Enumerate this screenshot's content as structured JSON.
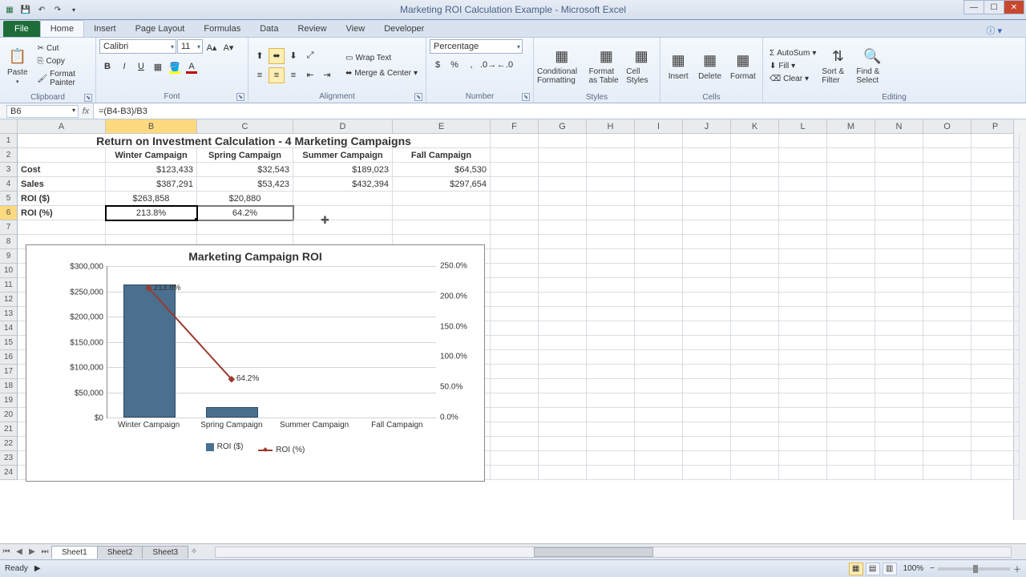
{
  "title": "Marketing ROI Calculation Example - Microsoft Excel",
  "tabs": {
    "file": "File",
    "items": [
      "Home",
      "Insert",
      "Page Layout",
      "Formulas",
      "Data",
      "Review",
      "View",
      "Developer"
    ],
    "active": 0
  },
  "ribbon": {
    "clipboard": {
      "label": "Clipboard",
      "paste": "Paste",
      "cut": "Cut",
      "copy": "Copy",
      "fp": "Format Painter"
    },
    "font": {
      "label": "Font",
      "name": "Calibri",
      "size": "11"
    },
    "alignment": {
      "label": "Alignment",
      "wrap": "Wrap Text",
      "merge": "Merge & Center"
    },
    "number": {
      "label": "Number",
      "fmt": "Percentage"
    },
    "styles": {
      "label": "Styles",
      "cf": "Conditional Formatting",
      "fat": "Format as Table",
      "cs": "Cell Styles"
    },
    "cells": {
      "label": "Cells",
      "insert": "Insert",
      "delete": "Delete",
      "format": "Format"
    },
    "editing": {
      "label": "Editing",
      "sum": "AutoSum",
      "fill": "Fill",
      "clear": "Clear",
      "sort": "Sort & Filter",
      "find": "Find & Select"
    }
  },
  "namebox": "B6",
  "formula": "=(B4-B3)/B3",
  "cols": {
    "A": 110,
    "B": 114,
    "C": 120,
    "D": 124,
    "E": 122,
    "rest": 60
  },
  "table": {
    "title": "Return on Investment Calculation - 4 Marketing Campaigns",
    "headers": [
      "Winter Campaign",
      "Spring Campaign",
      "Summer Campaign",
      "Fall Campaign"
    ],
    "rows": [
      {
        "label": "Cost",
        "vals": [
          "$123,433",
          "$32,543",
          "$189,023",
          "$64,530"
        ]
      },
      {
        "label": "Sales",
        "vals": [
          "$387,291",
          "$53,423",
          "$432,394",
          "$297,654"
        ]
      },
      {
        "label": "ROI ($)",
        "vals": [
          "$263,858",
          "$20,880",
          "",
          ""
        ]
      },
      {
        "label": "ROI (%)",
        "vals": [
          "213.8%",
          "64.2%",
          "",
          ""
        ]
      }
    ]
  },
  "chart_data": {
    "type": "bar",
    "title": "Marketing Campaign ROI",
    "categories": [
      "Winter Campaign",
      "Spring Campaign",
      "Summer Campaign",
      "Fall Campaign"
    ],
    "series": [
      {
        "name": "ROI ($)",
        "type": "bar",
        "values": [
          263858,
          20880,
          null,
          null
        ],
        "axis": "left",
        "color": "#4a6f8f"
      },
      {
        "name": "ROI (%)",
        "type": "line",
        "values": [
          213.8,
          64.2,
          null,
          null
        ],
        "axis": "right",
        "color": "#9a3a2e",
        "labels": [
          "213.8%",
          "64.2%"
        ]
      }
    ],
    "y_left": {
      "min": 0,
      "max": 300000,
      "ticks": [
        "$0",
        "$50,000",
        "$100,000",
        "$150,000",
        "$200,000",
        "$250,000",
        "$300,000"
      ]
    },
    "y_right": {
      "min": 0,
      "max": 250,
      "ticks": [
        "0.0%",
        "50.0%",
        "100.0%",
        "150.0%",
        "200.0%",
        "250.0%"
      ]
    }
  },
  "sheets": [
    "Sheet1",
    "Sheet2",
    "Sheet3"
  ],
  "status": {
    "ready": "Ready",
    "zoom": "100%"
  }
}
